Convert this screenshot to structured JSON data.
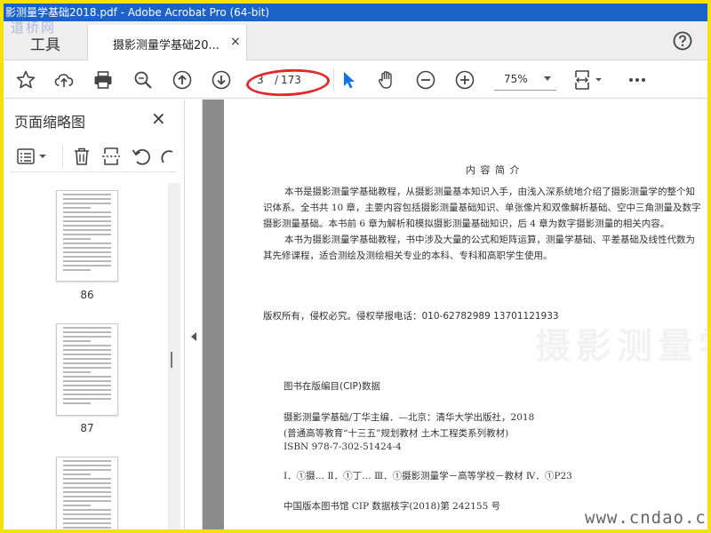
{
  "window": {
    "title": "影测量学基础2018.pdf - Adobe Acrobat Pro (64-bit)"
  },
  "watermark_top": "道桥网",
  "tabs": {
    "tools": "工具",
    "document": "摄影测量学基础20...",
    "close": "×"
  },
  "toolbar": {
    "page_current": "3",
    "page_separator": "/",
    "page_total": "173",
    "zoom": "75%"
  },
  "sidebar": {
    "title": "页面缩略图",
    "close": "×",
    "thumbnails": [
      {
        "page": "86"
      },
      {
        "page": "87"
      },
      {
        "page": ""
      }
    ]
  },
  "document": {
    "heading": "内 容 简 介",
    "summary_lines": [
      "本书是摄影测量学基础教程，从摄影测量基本知识入手，由浅入深系统地介绍了摄影测量学的整个知",
      "识体系。全书共 10 章，主要内容包括摄影测量基础知识、单张像片和双像解析基础、空中三角测量及数字",
      "摄影测量基础。本书前 6 章为解析和模拟摄影测量基础知识，后 4 章为数字摄影测量的相关内容。",
      "本书为摄影测量学基础教程，书中涉及大量的公式和矩阵运算，测量学基础、平差基础及线性代数为",
      "其先修课程，适合测绘及测绘相关专业的本科、专科和高职学生使用。"
    ],
    "rights": "版权所有，侵权必究。侵权举报电话：010-62782989   13701121933",
    "cip_title": "图书在版编目(CIP)数据",
    "cip_lines": [
      "摄影测量学基础/丁华主编．—北京：清华大学出版社，2018",
      "(普通高等教育“十三五”规划教材   土木工程类系列教材)",
      "ISBN 978-7-302-51424-4",
      "Ⅰ．①摄…   Ⅱ．①丁…   Ⅲ．①摄影测量学－高等学校－教材   Ⅳ．①P23",
      "中国版本图书馆 CIP 数据核字(2018)第 242155 号"
    ],
    "stamp_text": "摄影测量学基础"
  },
  "watermark_bottom": "www.cndao.com",
  "colors": {
    "titlebar": "#1c62c8",
    "frame": "#f5e10d",
    "highlight_ellipse": "#e22828",
    "select_tool": "#1473e6"
  }
}
